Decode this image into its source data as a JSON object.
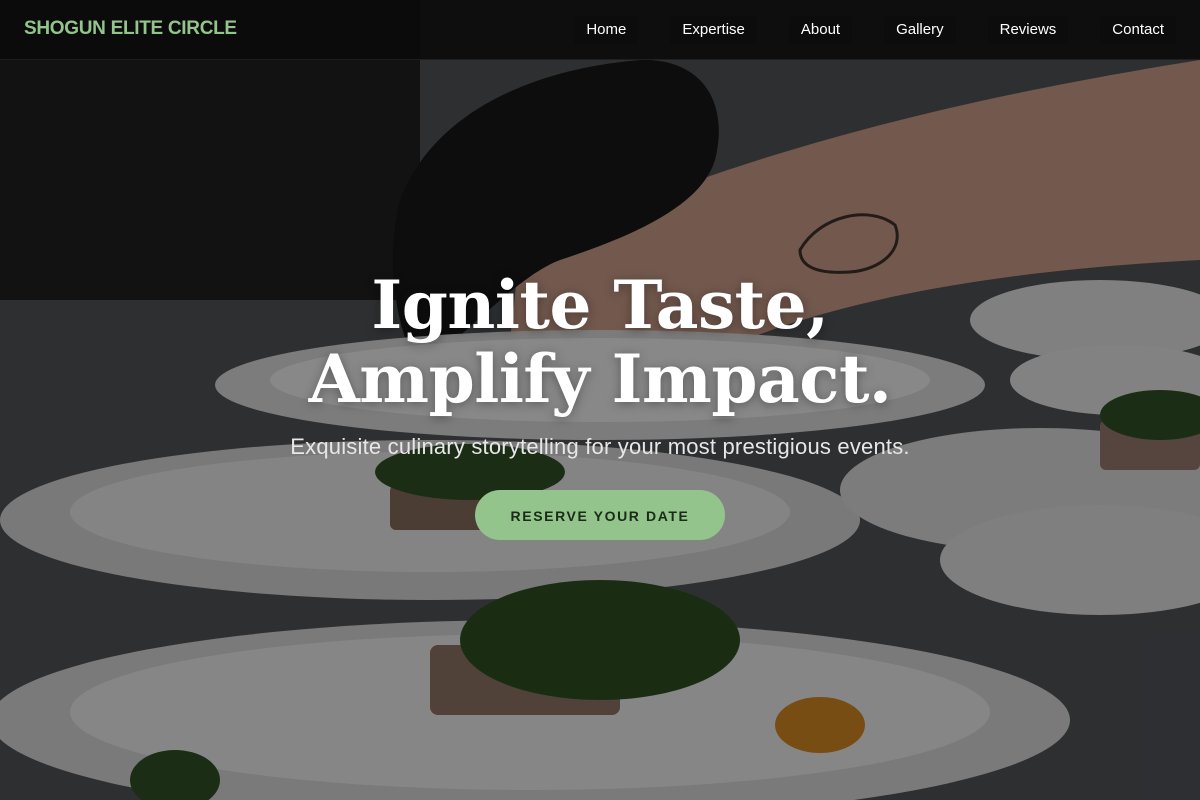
{
  "brand": {
    "name": "SHOGUN ELITE CIRCLE",
    "color": "#93c48b"
  },
  "nav": {
    "items": [
      {
        "label": "Home"
      },
      {
        "label": "Expertise"
      },
      {
        "label": "About"
      },
      {
        "label": "Gallery"
      },
      {
        "label": "Reviews"
      },
      {
        "label": "Contact"
      }
    ]
  },
  "hero": {
    "title": "Ignite Taste, Amplify Impact.",
    "subtitle": "Exquisite culinary storytelling for your most prestigious events.",
    "cta_label": "RESERVE YOUR DATE",
    "cta_color": "#93c48b",
    "background_image": "chef-plating-dishes-photo"
  }
}
